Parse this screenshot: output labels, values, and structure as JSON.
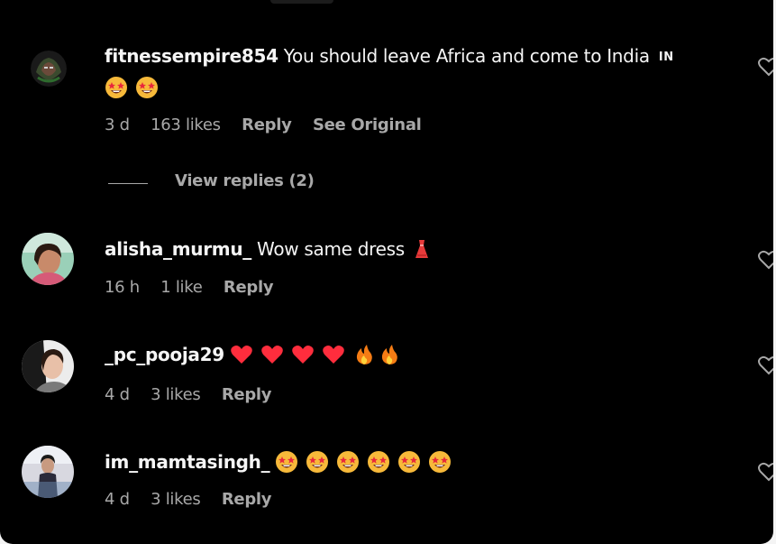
{
  "comments": [
    {
      "username": "fitnessempire854",
      "text": "You should leave Africa and come to India",
      "country_code": "IN",
      "emoji_line": [
        "star-struck",
        "star-struck"
      ],
      "time": "3 d",
      "likes": "163 likes",
      "reply_label": "Reply",
      "see_original_label": "See Original",
      "avatar_icon": "avatar-round-face"
    },
    {
      "username": "alisha_murmu_",
      "text": "Wow same dress",
      "inline_emoji": [
        "dress"
      ],
      "time": "16 h",
      "likes": "1 like",
      "reply_label": "Reply",
      "avatar_icon": "avatar-photo"
    },
    {
      "username": "_pc_pooja29",
      "text": "",
      "inline_emoji": [
        "red-heart",
        "red-heart",
        "red-heart",
        "red-heart",
        "fire",
        "fire"
      ],
      "time": "4 d",
      "likes": "3 likes",
      "reply_label": "Reply",
      "avatar_icon": "avatar-photo"
    },
    {
      "username": "im_mamtasingh_",
      "text": "",
      "inline_emoji": [
        "star-struck",
        "star-struck",
        "star-struck",
        "star-struck",
        "star-struck",
        "star-struck"
      ],
      "time": "4 d",
      "likes": "3 likes",
      "reply_label": "Reply",
      "avatar_icon": "avatar-photo"
    }
  ],
  "view_replies_label": "View replies (2)",
  "colors": {
    "background": "#000000",
    "primary_text": "#f5f5f5",
    "secondary_text": "#a8a8a8",
    "heart_red": "#ff2d3d",
    "emoji_face": "#f7b93a",
    "emoji_eye_red": "#e8283c"
  }
}
